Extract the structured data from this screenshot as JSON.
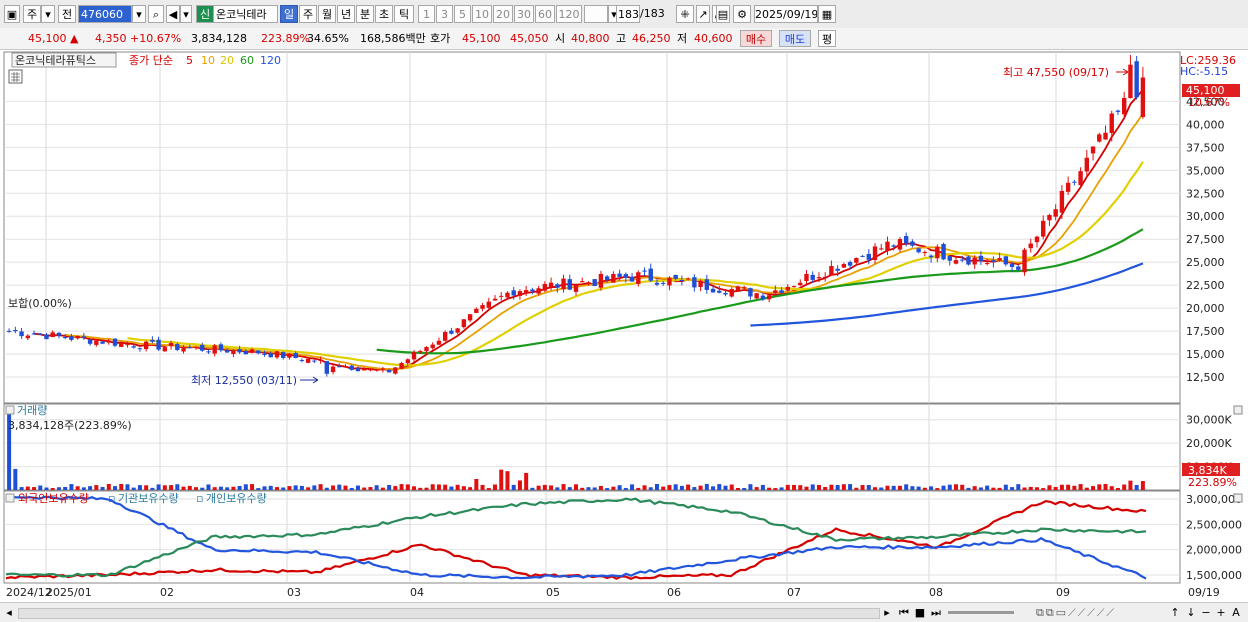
{
  "toolbar": {
    "market": "주",
    "mode": "전",
    "code": "476060",
    "badge": "신",
    "stock_name": "온코닉테라",
    "periods": [
      "일",
      "주",
      "월",
      "년",
      "분",
      "초",
      "틱"
    ],
    "selected_period": "일",
    "intervals": [
      "1",
      "3",
      "5",
      "10",
      "20",
      "30",
      "60",
      "120"
    ],
    "count": "183",
    "count_total": "/183",
    "date": "2025/09/19"
  },
  "quote": {
    "price": "45,100 ▲",
    "change": "4,350",
    "change_pct": "+10.67%",
    "volume": "3,834,128",
    "vol_ratio": "223.89%",
    "turnover": "34.65%",
    "amount": "168,586백만",
    "ask_label": "호가",
    "ask1": "45,100",
    "ask2": "45,050",
    "open_label": "시",
    "open": "40,800",
    "high_label": "고",
    "high": "46,250",
    "low_label": "저",
    "low": "40,600",
    "buy_btn": "매수",
    "sell_btn": "매도",
    "eval_btn": "평"
  },
  "price_panel": {
    "title": "온코닉테라퓨틱스",
    "legend_label": "종가 단순",
    "ma_labels": [
      "5",
      "10",
      "20",
      "60",
      "120"
    ],
    "ma_colors": [
      "#d40000",
      "#e8a000",
      "#e0d000",
      "#1a9a1a",
      "#2255dd"
    ],
    "lc": "LC:259.36",
    "hc": "HC:-5.15",
    "left_note": "보합(0.00%)",
    "high_note": "최고 47,550 (09/17)",
    "low_note": "최저 12,550 (03/11)",
    "last_price_tag": "45,100",
    "last_pct_tag": "10.67%",
    "yticks": [
      "42,500",
      "40,000",
      "37,500",
      "35,000",
      "32,500",
      "30,000",
      "27,500",
      "25,000",
      "22,500",
      "20,000",
      "17,500",
      "15,000",
      "12,500"
    ]
  },
  "volume_panel": {
    "title": "거래량",
    "value_note": "3,834,128주(223.89%)",
    "yticks": [
      "30,000K",
      "20,000K",
      "10,000K"
    ],
    "last_tag": "3,834K",
    "last_pct": "223.89%"
  },
  "holdings_panel": {
    "series": [
      {
        "name": "외국인보유수량",
        "color": "#d40000"
      },
      {
        "name": "기관보유수량",
        "color": "#2255dd"
      },
      {
        "name": "개인보유수량",
        "color": "#2a8a5a"
      }
    ],
    "yticks": [
      "3,000,000",
      "2,500,000",
      "2,000,000",
      "1,500,000"
    ]
  },
  "xaxis": {
    "labels": [
      "2024/12",
      "2025/01",
      "02",
      "03",
      "04",
      "05",
      "06",
      "07",
      "08",
      "09"
    ],
    "right_label": "09/19"
  },
  "chart_data": [
    {
      "type": "candlestick",
      "title": "온코닉테라퓨틱스",
      "ylim": [
        10000,
        47550
      ],
      "x_range": [
        "2024/12",
        "2025/09/19"
      ],
      "high": {
        "value": 47550,
        "date": "09/17"
      },
      "low": {
        "value": 12550,
        "date": "03/11"
      },
      "last": {
        "close": 45100,
        "open": 40800,
        "high": 46250,
        "low": 40600,
        "change": 4350,
        "change_pct": 10.67
      },
      "approx_close_path": [
        {
          "month": "2024/12",
          "close": 17500
        },
        {
          "month": "2025/01",
          "close": 16000
        },
        {
          "month": "02",
          "close": 15200
        },
        {
          "month": "03",
          "close": 13000
        },
        {
          "month": "04",
          "close": 22000
        },
        {
          "month": "05",
          "close": 23500
        },
        {
          "month": "06",
          "close": 21500
        },
        {
          "month": "07",
          "close": 27000
        },
        {
          "month": "08",
          "close": 24500
        },
        {
          "month": "09",
          "close": 45100
        }
      ],
      "moving_averages": [
        "5",
        "10",
        "20",
        "60",
        "120"
      ]
    },
    {
      "type": "bar",
      "title": "거래량",
      "unit": "주",
      "ylim": [
        0,
        35000000
      ],
      "last_value": 3834128,
      "last_ratio_pct": 223.89
    },
    {
      "type": "line",
      "ylim": [
        1400000,
        3100000
      ],
      "series": [
        {
          "name": "외국인보유수량",
          "approx": [
            1450000,
            1500000,
            1600000,
            1550000,
            2100000,
            1500000,
            1450000,
            1500000,
            2400000,
            2050000,
            2950000,
            2750000
          ]
        },
        {
          "name": "기관보유수량",
          "approx": [
            3050000,
            3000000,
            2000000,
            1950000,
            1500000,
            1450000,
            1500000,
            1800000,
            2050000,
            2050000,
            2200000,
            1450000
          ]
        },
        {
          "name": "개인보유수량",
          "approx": [
            1500000,
            1500000,
            2250000,
            2300000,
            2650000,
            2900000,
            3000000,
            2750000,
            2200000,
            2250000,
            2400000,
            2350000
          ]
        }
      ]
    }
  ]
}
